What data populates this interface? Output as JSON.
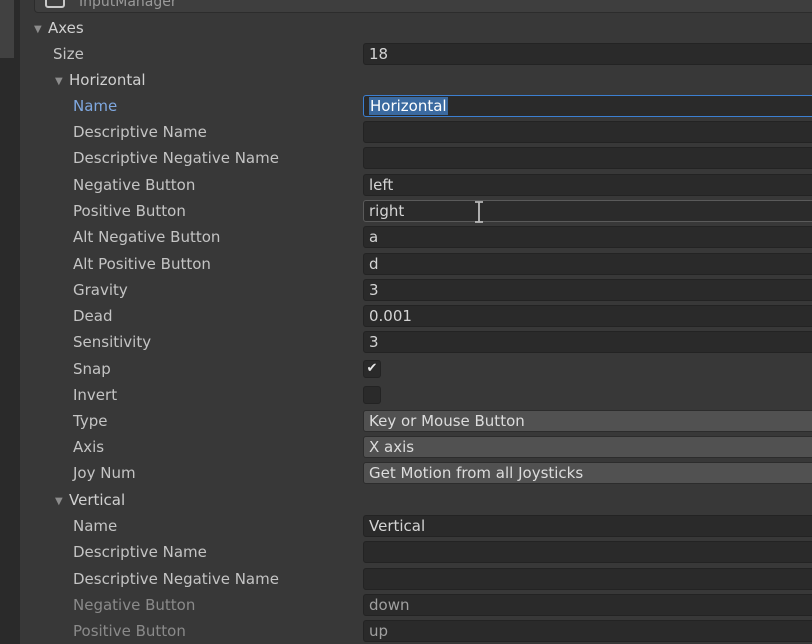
{
  "header": {
    "object_name": "InputManager"
  },
  "axes": {
    "label": "Axes",
    "size_label": "Size",
    "size_value": "18"
  },
  "horizontal": {
    "label": "Horizontal",
    "name_label": "Name",
    "name_value": "Horizontal",
    "descriptive_name_label": "Descriptive Name",
    "descriptive_name_value": "",
    "descriptive_negative_name_label": "Descriptive Negative Name",
    "descriptive_negative_name_value": "",
    "negative_button_label": "Negative Button",
    "negative_button_value": "left",
    "positive_button_label": "Positive Button",
    "positive_button_value": "right",
    "alt_negative_button_label": "Alt Negative Button",
    "alt_negative_button_value": "a",
    "alt_positive_button_label": "Alt Positive Button",
    "alt_positive_button_value": "d",
    "gravity_label": "Gravity",
    "gravity_value": "3",
    "dead_label": "Dead",
    "dead_value": "0.001",
    "sensitivity_label": "Sensitivity",
    "sensitivity_value": "3",
    "snap_label": "Snap",
    "snap_checked": true,
    "snap_glyph": "✔",
    "invert_label": "Invert",
    "invert_checked": false,
    "type_label": "Type",
    "type_value": "Key or Mouse Button",
    "axis_label": "Axis",
    "axis_value": "X axis",
    "joy_num_label": "Joy Num",
    "joy_num_value": "Get Motion from all Joysticks"
  },
  "vertical": {
    "label": "Vertical",
    "name_label": "Name",
    "name_value": "Vertical",
    "descriptive_name_label": "Descriptive Name",
    "descriptive_name_value": "",
    "descriptive_negative_name_label": "Descriptive Negative Name",
    "descriptive_negative_name_value": "",
    "negative_button_label": "Negative Button",
    "negative_button_value": "down",
    "positive_button_label": "Positive Button",
    "positive_button_value": "up"
  },
  "colors": {
    "background": "#383838",
    "field_background": "#2a2a2a",
    "focus_border": "#3c7fd1",
    "selection": "#3b6aa0",
    "active_label": "#7fa8e0"
  }
}
